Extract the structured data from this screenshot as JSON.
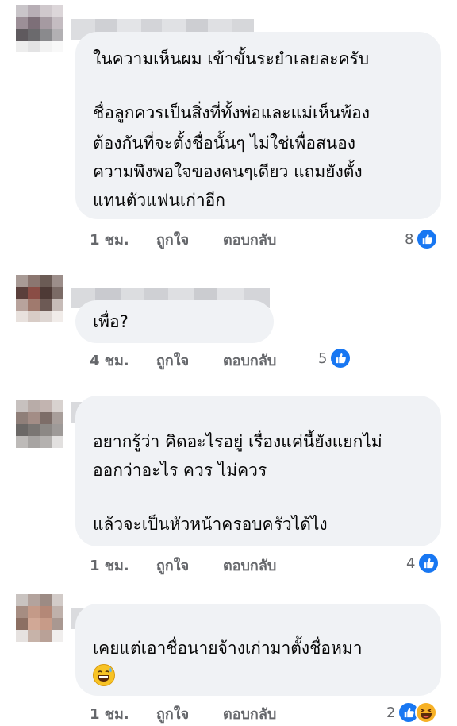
{
  "comments": [
    {
      "lines": [
        "ในความเห็นผม เข้าขั้นระยำเลยละครับ",
        "ชื่อลูกควรเป็นสิ่งที่ทั้งพ่อและแม่เห็นพ้อง",
        "ต้องกันที่จะตั้งชื่อนั้นๆ ไม่ใช่เพื่อสนอง",
        "ความพึงพอใจของคนๆเดียว แถมยังตั้ง",
        "แทนตัวแฟนเก่าอีก"
      ],
      "time": "1 ชม.",
      "like_label": "ถูกใจ",
      "reply_label": "ตอบกลับ",
      "reaction_count": "8",
      "reactions": [
        "like-icon"
      ]
    },
    {
      "lines": [
        "เพื่อ?"
      ],
      "time": "4 ชม.",
      "like_label": "ถูกใจ",
      "reply_label": "ตอบกลับ",
      "reaction_count": "5",
      "reactions": [
        "like-icon"
      ]
    },
    {
      "lines": [
        "อยากรู้ว่า คิดอะไรอยู่ เรื่องแค่นี้ยังแยกไม่",
        "ออกว่าอะไร ควร ไม่ควร",
        "แล้วจะเป็นหัวหน้าครอบครัวได้ไง"
      ],
      "time": "1 ชม.",
      "like_label": "ถูกใจ",
      "reply_label": "ตอบกลับ",
      "reaction_count": "4",
      "reactions": [
        "like-icon"
      ]
    },
    {
      "lines": [
        "เคยแต่เอาชื่อนายจ้างเก่ามาตั้งชื่อหมา"
      ],
      "emoji": "grinning-sweat-emoji",
      "time": "1 ชม.",
      "like_label": "ถูกใจ",
      "reply_label": "ตอบกลับ",
      "reaction_count": "2",
      "reactions": [
        "like-icon",
        "haha-icon"
      ]
    }
  ],
  "colors": {
    "bubble": "#f0f2f5",
    "meta_text": "#65676b",
    "like_blue": "#1877f2",
    "haha_yellow": "#f7b125"
  }
}
